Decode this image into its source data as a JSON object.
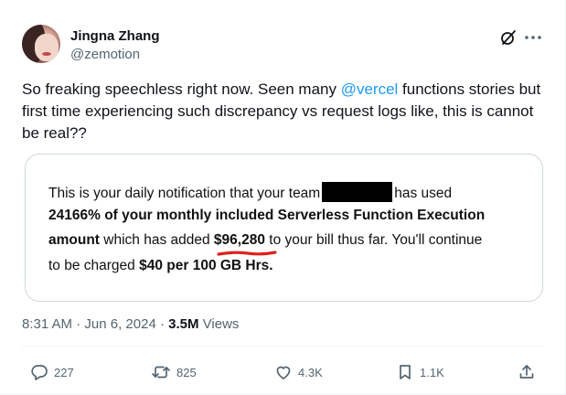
{
  "author": {
    "name": "Jingna Zhang",
    "handle": "@zemotion"
  },
  "tweet": {
    "text_before": "So freaking speechless right now. Seen many ",
    "mention": "@vercel",
    "text_after": " functions stories but first time experiencing such discrepancy vs request logs like, this is cannot be real??"
  },
  "media": {
    "line1_before": "This is your daily notification that your team",
    "line1_after": "has used",
    "line2": "24166% of your monthly included Serverless Function Execution",
    "line3_bold": "amount",
    "line3_mid": " which has added ",
    "line3_amount": "$96,280",
    "line3_after": " to your bill thus far. You'll continue",
    "line4_before": "to be charged ",
    "line4_bold": "$40 per 100 GB Hrs."
  },
  "meta": {
    "time": "8:31 AM",
    "sep1": " · ",
    "date": "Jun 6, 2024",
    "sep2": " · ",
    "views_count": "3.5M",
    "views_label": " Views"
  },
  "actions": {
    "replies": "227",
    "reposts": "825",
    "likes": "4.3K",
    "bookmarks": "1.1K"
  },
  "icons": {
    "reply": "reply-icon",
    "repost": "repost-icon",
    "like": "like-icon",
    "bookmark": "bookmark-icon",
    "share": "share-icon",
    "grok": "grok-icon",
    "more": "more-icon"
  },
  "colors": {
    "text": "#0f1419",
    "secondary": "#536471",
    "link": "#1d9bf0",
    "border": "#cfd9de",
    "annotation": "#e0201b"
  }
}
